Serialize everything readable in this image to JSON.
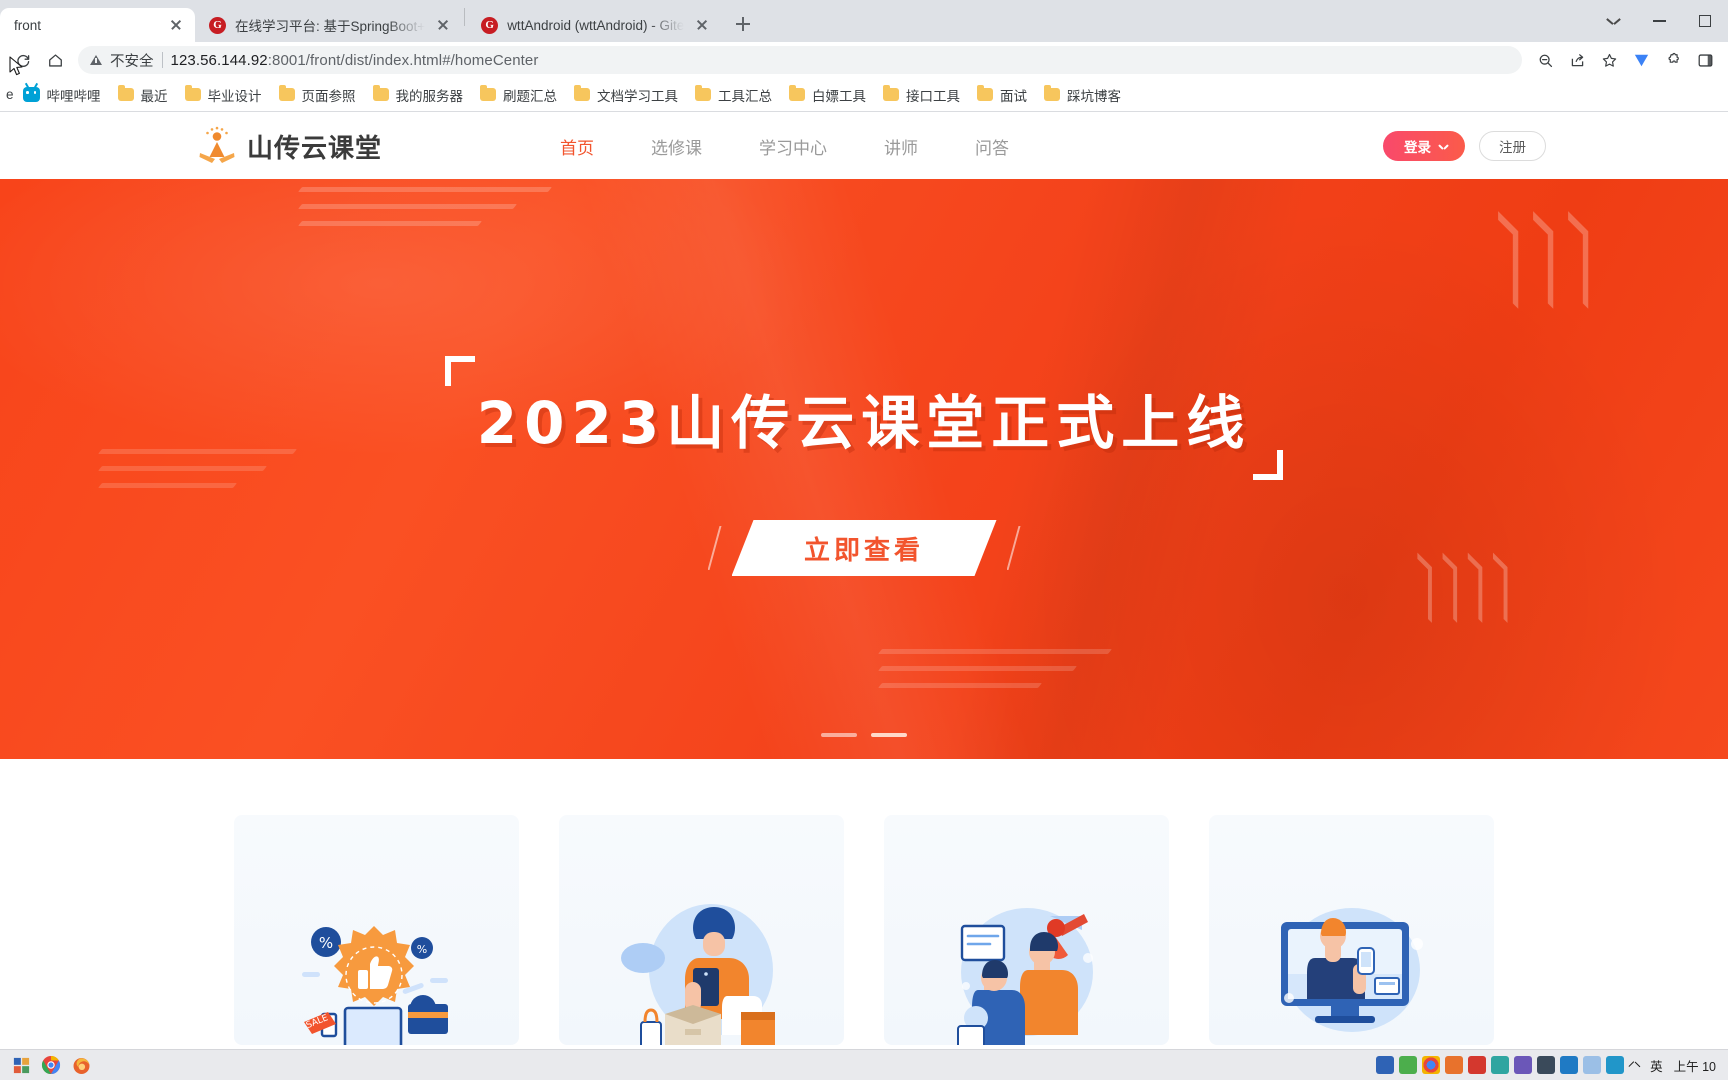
{
  "browser": {
    "tabs": [
      {
        "title": "front",
        "favicon": "none",
        "active": true
      },
      {
        "title": "在线学习平台: 基于SpringBoot+",
        "favicon": "gitee-icon",
        "active": false
      },
      {
        "title": "wttAndroid (wttAndroid) - Gite",
        "favicon": "gitee-icon",
        "active": false
      }
    ],
    "new_tab_label": "+",
    "window_controls": [
      "chevron-down",
      "minimize",
      "maximize"
    ],
    "toolbar": {
      "reload_label": "reload-icon",
      "home_label": "home-icon",
      "security_text": "不安全",
      "url": "123.56.144.92:8001/front/dist/index.html#/homeCenter",
      "url_host": "123.56.144.92",
      "url_rest": ":8001/front/dist/index.html#/homeCenter",
      "right_icons": [
        "zoom-out-icon",
        "share-icon",
        "bookmark-star-icon",
        "extension-v-icon",
        "extensions-icon",
        "sidebar-icon"
      ]
    },
    "bookmarks": [
      {
        "label": "哔哩哔哩",
        "icon": "bilibili-icon"
      },
      {
        "label": "最近",
        "icon": "folder-icon"
      },
      {
        "label": "毕业设计",
        "icon": "folder-icon"
      },
      {
        "label": "页面参照",
        "icon": "folder-icon"
      },
      {
        "label": "我的服务器",
        "icon": "folder-icon"
      },
      {
        "label": "刷题汇总",
        "icon": "folder-icon"
      },
      {
        "label": "文档学习工具",
        "icon": "folder-icon"
      },
      {
        "label": "工具汇总",
        "icon": "folder-icon"
      },
      {
        "label": "白嫖工具",
        "icon": "folder-icon"
      },
      {
        "label": "接口工具",
        "icon": "folder-icon"
      },
      {
        "label": "面试",
        "icon": "folder-icon"
      },
      {
        "label": "踩坑博客",
        "icon": "folder-icon"
      }
    ]
  },
  "site": {
    "logo_text": "山传云课堂",
    "nav": [
      {
        "label": "首页",
        "active": true
      },
      {
        "label": "选修课",
        "active": false
      },
      {
        "label": "学习中心",
        "active": false
      },
      {
        "label": "讲师",
        "active": false
      },
      {
        "label": "问答",
        "active": false
      }
    ],
    "login_label": "登录",
    "register_label": "注册",
    "accent_color": "#f2542d",
    "login_gradient_start": "#f9496b",
    "login_gradient_end": "#fb5b4a"
  },
  "hero": {
    "title": "2023山传云课堂正式上线",
    "cta_label": "立即查看",
    "background_color": "#f5481d",
    "slides": 2,
    "active_slide": 2
  },
  "cards": [
    {
      "illustration": "discount-thumbs-up-illustration"
    },
    {
      "illustration": "person-with-tablet-package-illustration"
    },
    {
      "illustration": "people-megaphone-announcement-illustration"
    },
    {
      "illustration": "person-at-desktop-computer-illustration"
    }
  ],
  "taskbar": {
    "pinned": [
      "start-icon",
      "chrome-icon",
      "firefox-icon"
    ],
    "tray_icons": [
      "tray-blue-icon",
      "tray-green-icon",
      "chrome-tray-icon",
      "tray-orange-icon",
      "tray-red-icon",
      "tray-teal-icon",
      "tray-purple-icon",
      "tray-dark-icon",
      "tray-mix-icon",
      "tray-light-icon",
      "tray-cyan-icon"
    ],
    "ime_label": "英",
    "clock": "上午 10"
  }
}
